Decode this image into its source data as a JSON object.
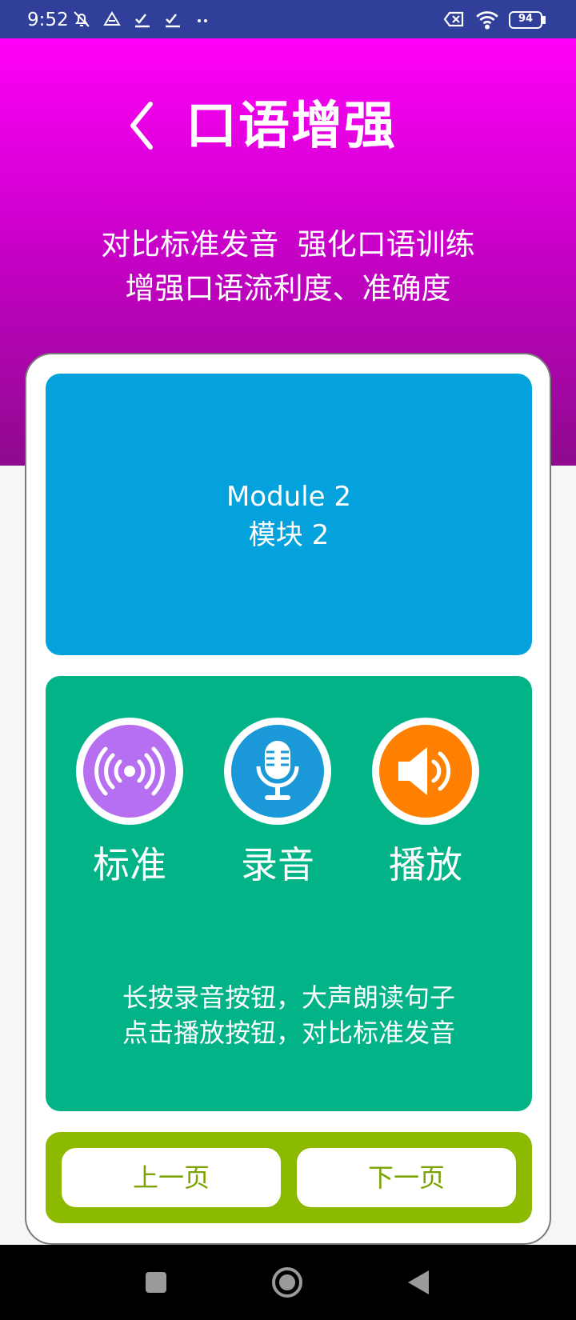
{
  "status_bar": {
    "time": "9:52",
    "left_icons": [
      "notification-off-icon",
      "drive-icon",
      "check-icon",
      "check-icon",
      "more-dots-icon"
    ],
    "right_icons": [
      "no-sim-icon",
      "wifi-icon",
      "battery-icon"
    ],
    "battery_level": "94"
  },
  "header": {
    "title": "口语增强",
    "subtitle_line1": "对比标准发音  强化口语训练",
    "subtitle_line2": "增强口语流利度、准确度"
  },
  "module": {
    "name_en": "Module 2",
    "name_zh": "模块 2"
  },
  "actions": {
    "standard_label": "标准",
    "record_label": "录音",
    "play_label": "播放"
  },
  "tips": {
    "line1": "长按录音按钮，大声朗读句子",
    "line2": "点击播放按钮，对比标准发音"
  },
  "pagination": {
    "prev_label": "上一页",
    "next_label": "下一页"
  },
  "colors": {
    "header_top": "#ff00f7",
    "header_bottom": "#8e0a8e",
    "module_blue": "#03a2dc",
    "practice_green": "#02b388",
    "nav_green": "#8cba00",
    "standard_purple": "#b56ff0",
    "record_blue": "#1a98d8",
    "play_orange": "#ff7f00"
  }
}
